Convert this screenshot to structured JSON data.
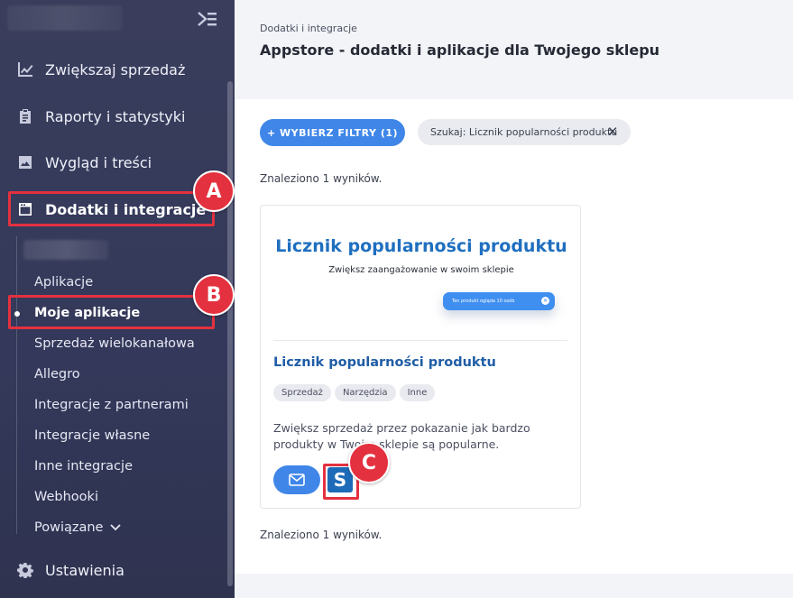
{
  "sidebar": {
    "main_items": [
      {
        "label": "Zwiększaj sprzedaż",
        "icon": "chart-line-icon"
      },
      {
        "label": "Raporty i statystyki",
        "icon": "clipboard-icon"
      },
      {
        "label": "Wygląd i treści",
        "icon": "image-icon"
      },
      {
        "label": "Dodatki i integracje",
        "icon": "window-icon"
      }
    ],
    "sub_items": [
      "Aplikacje",
      "Moje aplikacje",
      "Sprzedaż wielokanałowa",
      "Allegro",
      "Integracje z partnerami",
      "Integracje własne",
      "Inne integracje",
      "Webhooki",
      "Powiązane"
    ],
    "settings_label": "Ustawienia"
  },
  "annotations": {
    "a": "A",
    "b": "B",
    "c": "C"
  },
  "header": {
    "breadcrumb": "Dodatki i integracje",
    "title": "Appstore - dodatki i aplikacje dla Twojego sklepu"
  },
  "filters": {
    "button_label": "+ WYBIERZ FILTRY (1)",
    "search_chip": "Szukaj: Licznik popularności produktu"
  },
  "results_text": "Znaleziono 1 wyników.",
  "card": {
    "banner_title": "Licznik popularności produktu",
    "banner_subtitle": "Zwiększ zaangażowanie w swoim sklepie",
    "banner_pill": "Ten produkt ogląda 10 osób",
    "title": "Licznik popularności produktu",
    "tags": [
      "Sprzedaż",
      "Narzędzia",
      "Inne"
    ],
    "description": "Zwiększ sprzedaż przez pokazanie jak bardzo produkty w Twoim sklepie są popularne.",
    "vendor_letter": "S"
  },
  "colors": {
    "accent": "#3f86e8",
    "annotation": "#e4313f",
    "sidebar": "#3a3e5c"
  }
}
